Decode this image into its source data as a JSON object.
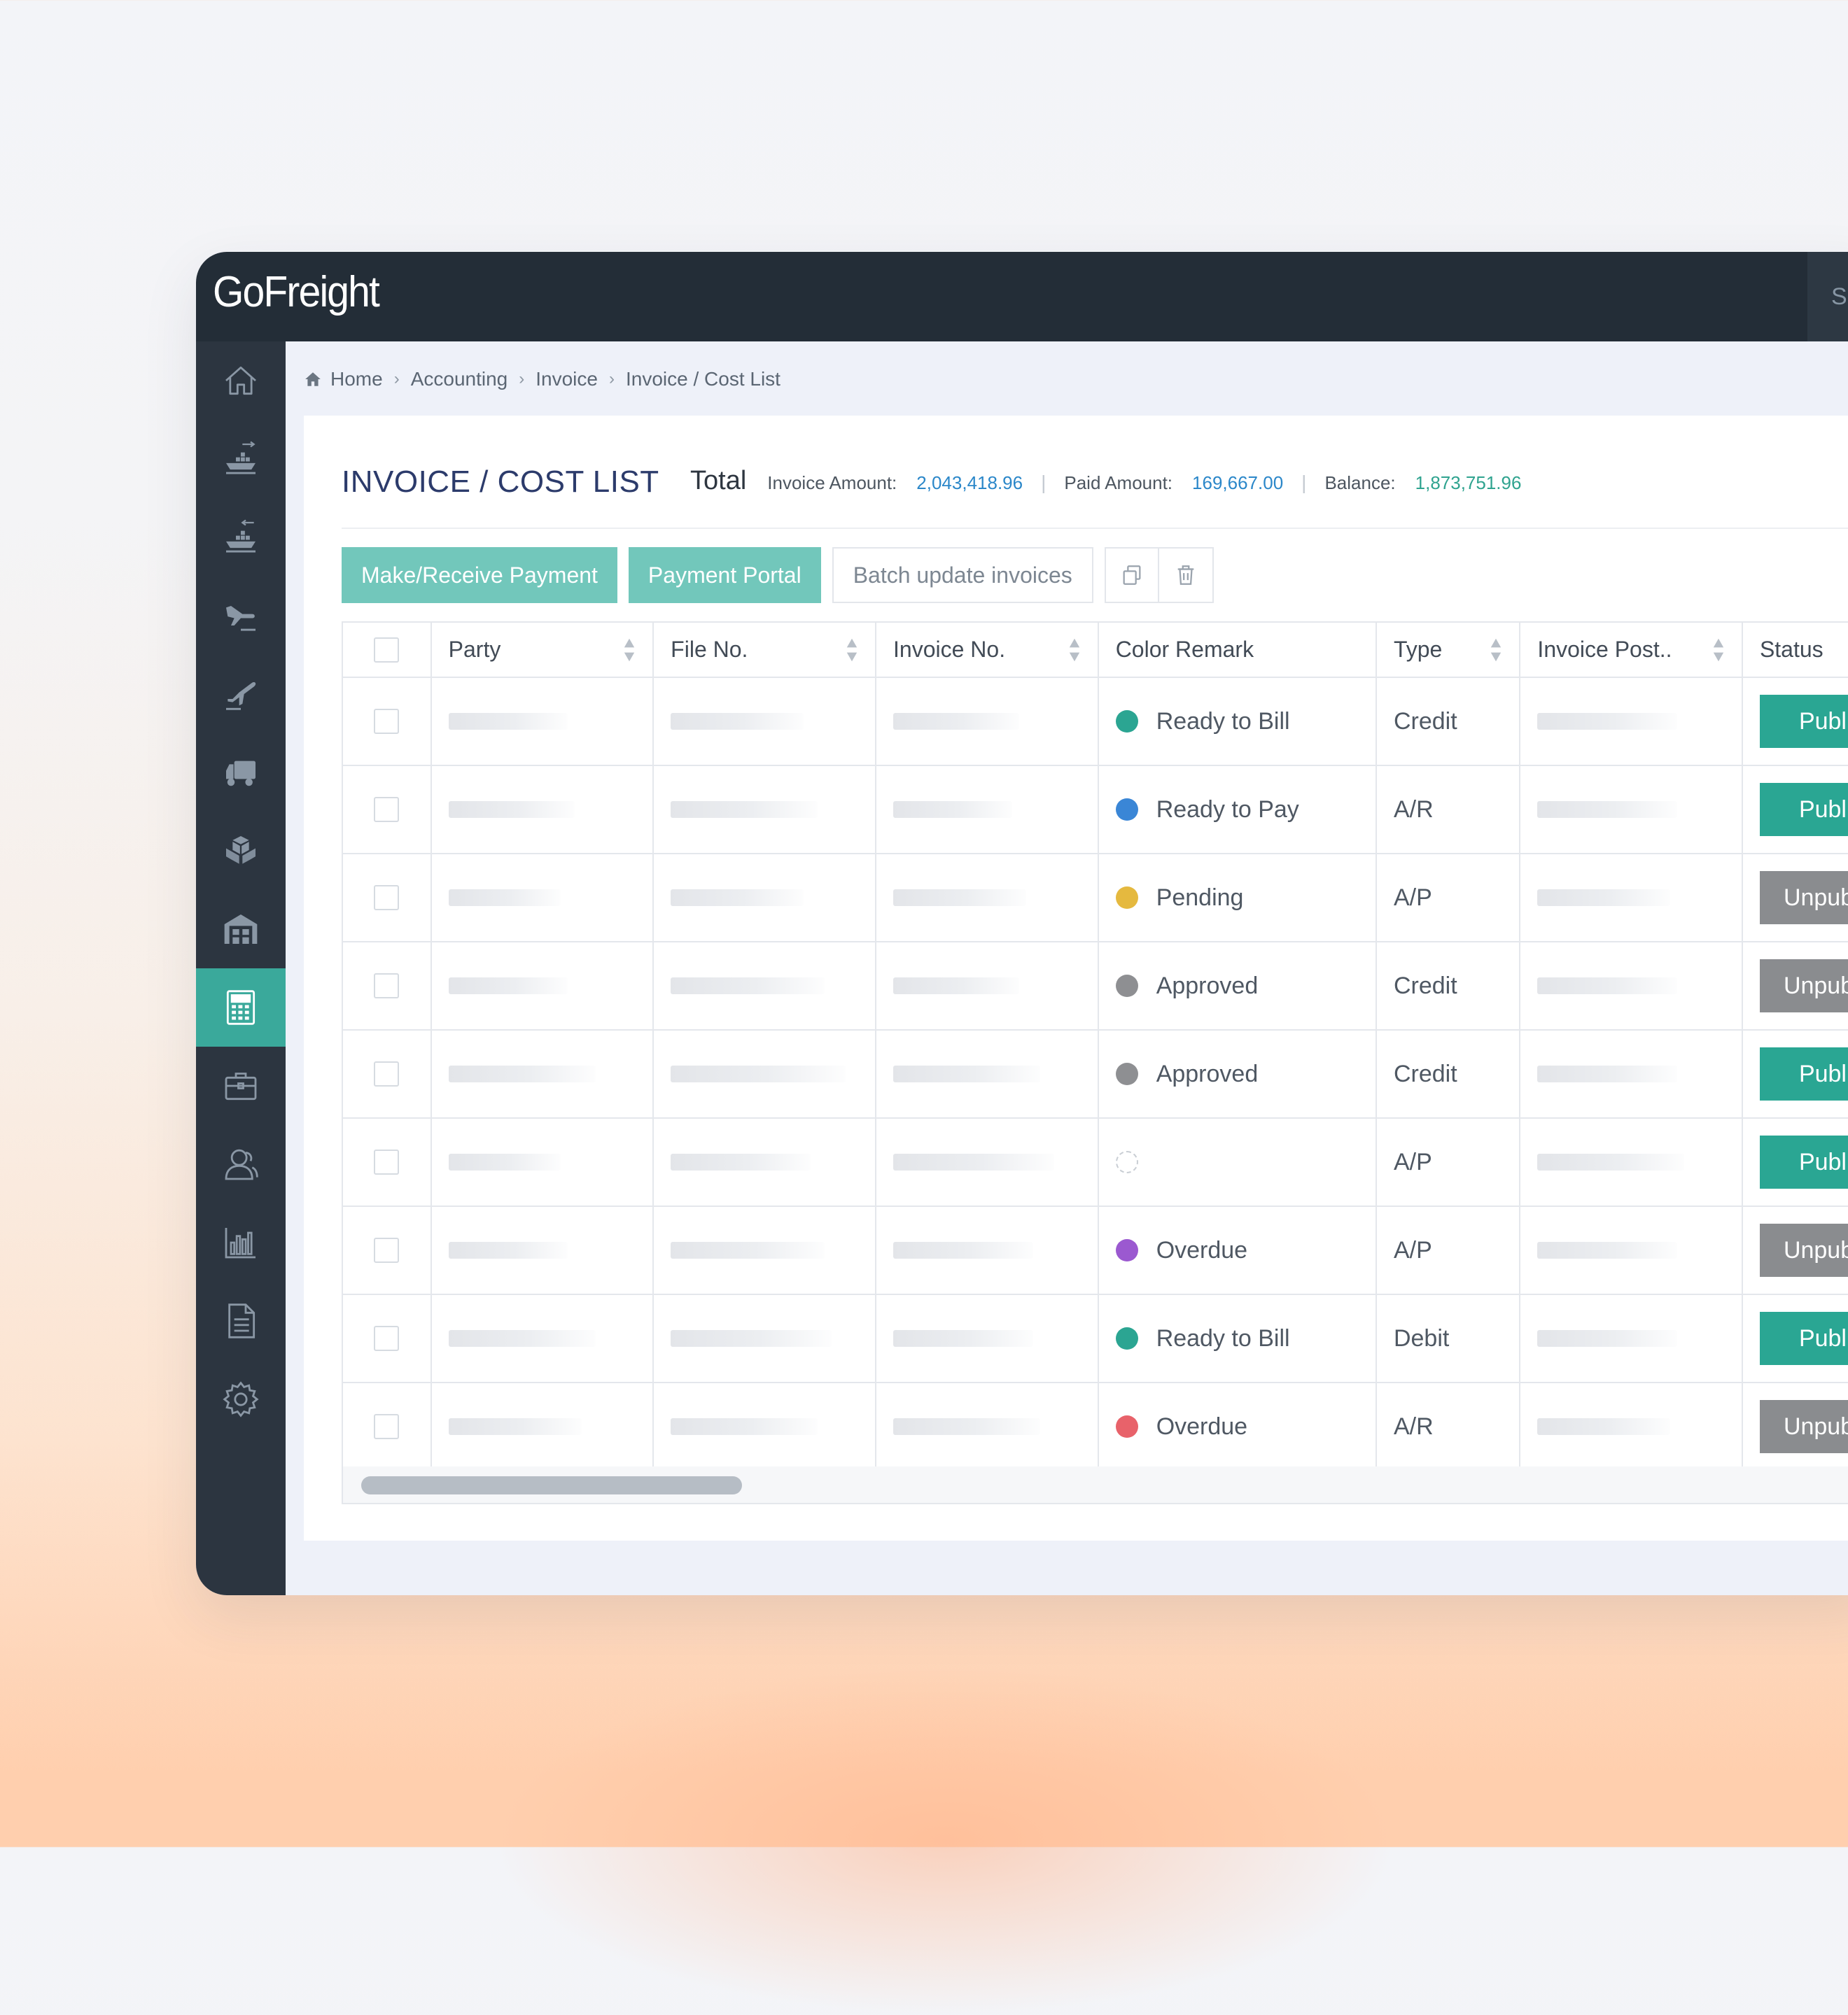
{
  "app": {
    "logo": "GoFreight",
    "search_label": "Se"
  },
  "sidebar": {
    "items": [
      {
        "icon": "home-icon"
      },
      {
        "icon": "ocean-export-icon"
      },
      {
        "icon": "ocean-import-icon"
      },
      {
        "icon": "air-import-icon"
      },
      {
        "icon": "air-export-icon"
      },
      {
        "icon": "truck-icon"
      },
      {
        "icon": "boxes-icon"
      },
      {
        "icon": "warehouse-icon"
      },
      {
        "icon": "calculator-icon",
        "active": true
      },
      {
        "icon": "briefcase-icon"
      },
      {
        "icon": "contacts-icon"
      },
      {
        "icon": "bar-chart-icon"
      },
      {
        "icon": "document-icon"
      },
      {
        "icon": "gear-icon"
      }
    ]
  },
  "breadcrumb": {
    "items": [
      "Home",
      "Accounting",
      "Invoice",
      "Invoice / Cost List"
    ]
  },
  "page": {
    "title": "INVOICE / COST LIST",
    "total_label": "Total",
    "invoice_amount_label": "Invoice Amount:",
    "invoice_amount": "2,043,418.96",
    "paid_amount_label": "Paid Amount:",
    "paid_amount": "169,667.00",
    "balance_label": "Balance:",
    "balance": "1,873,751.96"
  },
  "toolbar": {
    "make_payment": "Make/Receive Payment",
    "payment_portal": "Payment Portal",
    "batch_update": "Batch update invoices"
  },
  "table": {
    "columns": [
      "Party",
      "File No.",
      "Invoice No.",
      "Color Remark",
      "Type",
      "Invoice Post..",
      "Status"
    ],
    "rows": [
      {
        "remark": "Ready to Bill",
        "color": "#2ba592",
        "type": "Credit",
        "status": "Publi",
        "published": true
      },
      {
        "remark": "Ready to Pay",
        "color": "#3a86d6",
        "type": "A/R",
        "status": "Publi",
        "published": true
      },
      {
        "remark": "Pending",
        "color": "#e5b93f",
        "type": "A/P",
        "status": "Unpub",
        "published": false
      },
      {
        "remark": "Approved",
        "color": "#8e8f92",
        "type": "Credit",
        "status": "Unpub",
        "published": false
      },
      {
        "remark": "Approved",
        "color": "#8e8f92",
        "type": "Credit",
        "status": "Publi",
        "published": true
      },
      {
        "remark": "",
        "color": "",
        "type": "A/P",
        "status": "Publi",
        "published": true
      },
      {
        "remark": "Overdue",
        "color": "#9b59d0",
        "type": "A/P",
        "status": "Unpub",
        "published": false
      },
      {
        "remark": "Ready to Bill",
        "color": "#2ba592",
        "type": "Debit",
        "status": "Publi",
        "published": true
      },
      {
        "remark": "Overdue",
        "color": "#e8626a",
        "type": "A/R",
        "status": "Unpub",
        "published": false
      }
    ]
  },
  "colors": {
    "accent": "#3aa99b",
    "topbar": "#232d37",
    "sidebar": "#2c3540",
    "link": "#2b87c9"
  }
}
